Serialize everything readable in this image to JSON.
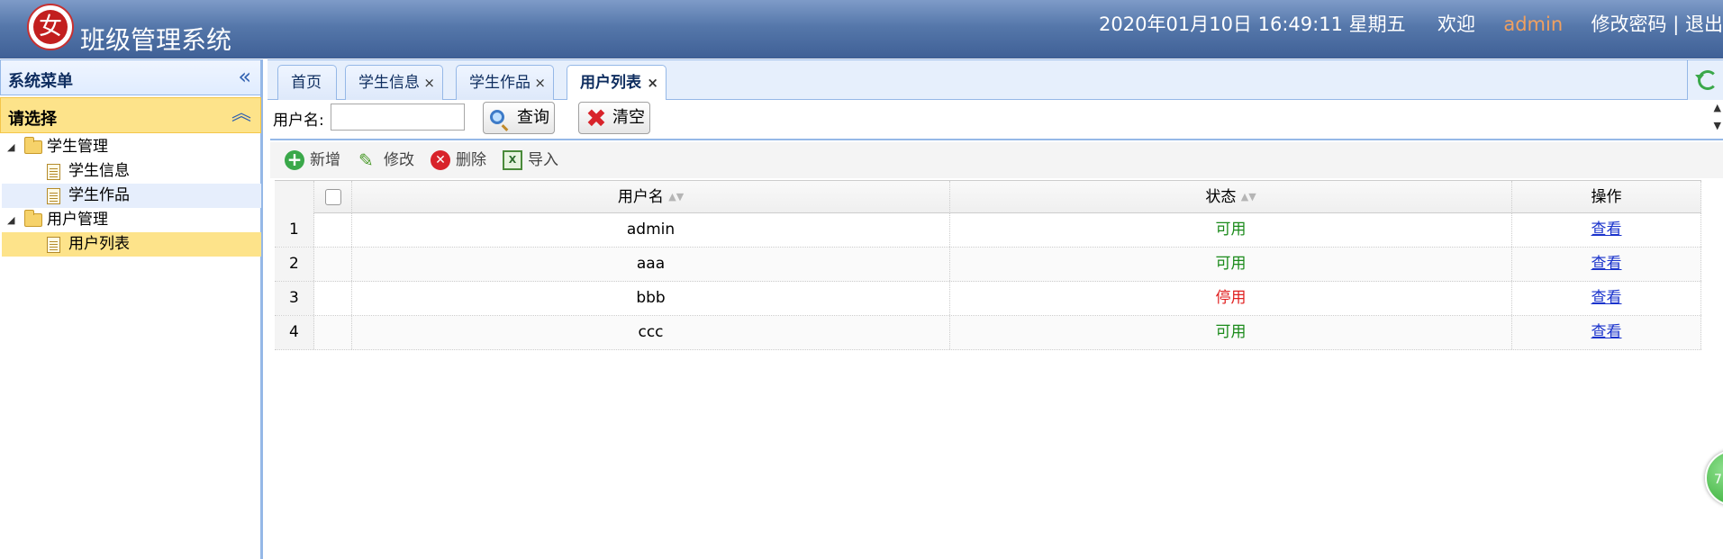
{
  "header": {
    "logo_char": "女",
    "app_title": "班级管理系统",
    "datetime": "2020年01月10日 16:49:11 星期五",
    "welcome": "欢迎",
    "username": "admin",
    "change_password": "修改密码",
    "separator": "|",
    "logout": "退出"
  },
  "sidebar": {
    "title": "系统菜单",
    "collapse_icon": "«",
    "section_title": "请选择",
    "section_icon": "︽",
    "tree": [
      {
        "label": "学生管理",
        "type": "folder",
        "expanded": true
      },
      {
        "label": "学生信息",
        "type": "file"
      },
      {
        "label": "学生作品",
        "type": "file"
      },
      {
        "label": "用户管理",
        "type": "folder",
        "expanded": true
      },
      {
        "label": "用户列表",
        "type": "file",
        "selected": true
      }
    ]
  },
  "tabs": [
    {
      "label": "首页",
      "closable": false
    },
    {
      "label": "学生信息",
      "closable": true
    },
    {
      "label": "学生作品",
      "closable": true
    },
    {
      "label": "用户列表",
      "closable": true,
      "active": true
    }
  ],
  "tab_close_glyph": "×",
  "search": {
    "label": "用户名:",
    "value": "",
    "placeholder": "",
    "query_button": "查询",
    "clear_button": "清空"
  },
  "toolbar": {
    "add": "新增",
    "edit": "修改",
    "delete": "删除",
    "import": "导入",
    "import_icon_text": "X"
  },
  "grid": {
    "columns": [
      "用户名",
      "状态",
      "操作"
    ],
    "rows": [
      {
        "num": "1",
        "username": "admin",
        "status": "可用",
        "status_kind": "ok",
        "action": "查看"
      },
      {
        "num": "2",
        "username": "aaa",
        "status": "可用",
        "status_kind": "ok",
        "action": "查看"
      },
      {
        "num": "3",
        "username": "bbb",
        "status": "停用",
        "status_kind": "off",
        "action": "查看"
      },
      {
        "num": "4",
        "username": "ccc",
        "status": "可用",
        "status_kind": "ok",
        "action": "查看"
      }
    ]
  },
  "floating_ball_text": "7",
  "colors": {
    "header_bg": "#5577aa",
    "accent_border": "#95b8e7",
    "selected_bg": "#fde38a",
    "status_ok": "#1a8a1a",
    "status_off": "#e02020",
    "link": "#1a33cc",
    "username_highlight": "#f0a060"
  }
}
